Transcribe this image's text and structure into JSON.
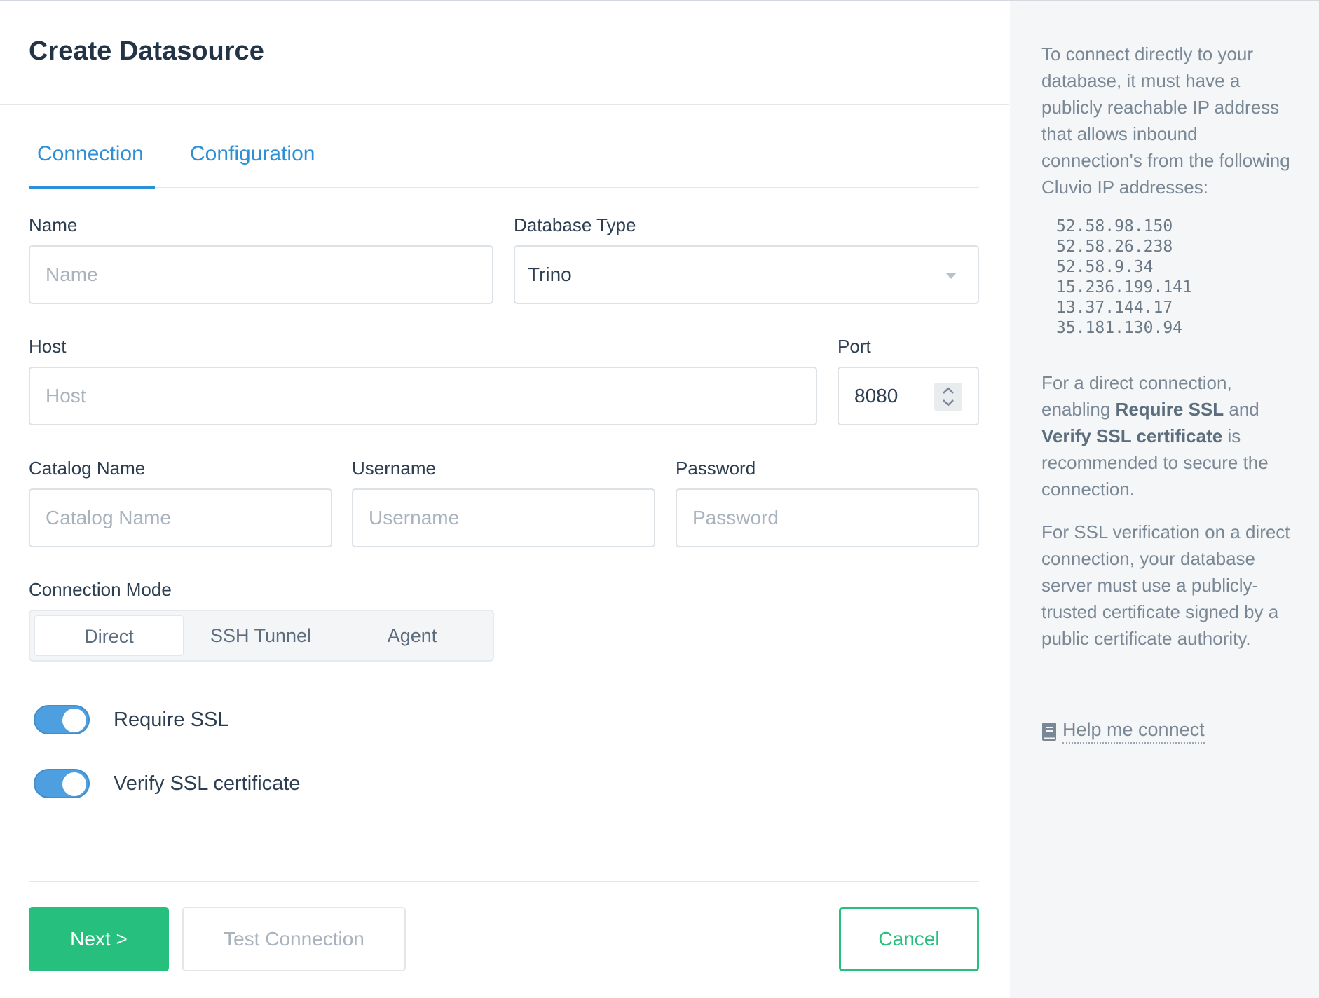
{
  "header": {
    "title": "Create Datasource"
  },
  "tabs": [
    {
      "label": "Connection",
      "active": true
    },
    {
      "label": "Configuration",
      "active": false
    }
  ],
  "form": {
    "name": {
      "label": "Name",
      "placeholder": "Name",
      "value": ""
    },
    "database_type": {
      "label": "Database Type",
      "value": "Trino"
    },
    "host": {
      "label": "Host",
      "placeholder": "Host",
      "value": ""
    },
    "port": {
      "label": "Port",
      "value": "8080"
    },
    "catalog_name": {
      "label": "Catalog Name",
      "placeholder": "Catalog Name",
      "value": ""
    },
    "username": {
      "label": "Username",
      "placeholder": "Username",
      "value": ""
    },
    "password": {
      "label": "Password",
      "placeholder": "Password",
      "value": ""
    },
    "connection_mode": {
      "label": "Connection Mode",
      "options": [
        "Direct",
        "SSH Tunnel",
        "Agent"
      ],
      "selected": "Direct"
    },
    "require_ssl": {
      "label": "Require SSL",
      "enabled": true
    },
    "verify_ssl": {
      "label": "Verify SSL certificate",
      "enabled": true
    }
  },
  "footer": {
    "next_label": "Next >",
    "test_label": "Test Connection",
    "cancel_label": "Cancel"
  },
  "sidebar": {
    "intro": "To connect directly to your database, it must have a publicly reachable IP address that allows inbound connection's from the following Cluvio IP addresses:",
    "ips": [
      "52.58.98.150",
      "52.58.26.238",
      "52.58.9.34",
      "15.236.199.141",
      "13.37.144.17",
      "35.181.130.94"
    ],
    "ssl_note_prefix": "For a direct connection, enabling ",
    "ssl_note_require": "Require SSL",
    "ssl_note_and": " and ",
    "ssl_note_verify": "Verify SSL certificate",
    "ssl_note_suffix": " is recommended to secure the connection.",
    "verification_note": "For SSL verification on a direct connection, your database server must use a publicly-trusted certificate signed by a public certificate authority.",
    "help_link": "Help me connect"
  },
  "colors": {
    "accent_blue": "#2d8fd5",
    "primary_green": "#27bf7e",
    "toggle_blue": "#4d9fe0"
  }
}
